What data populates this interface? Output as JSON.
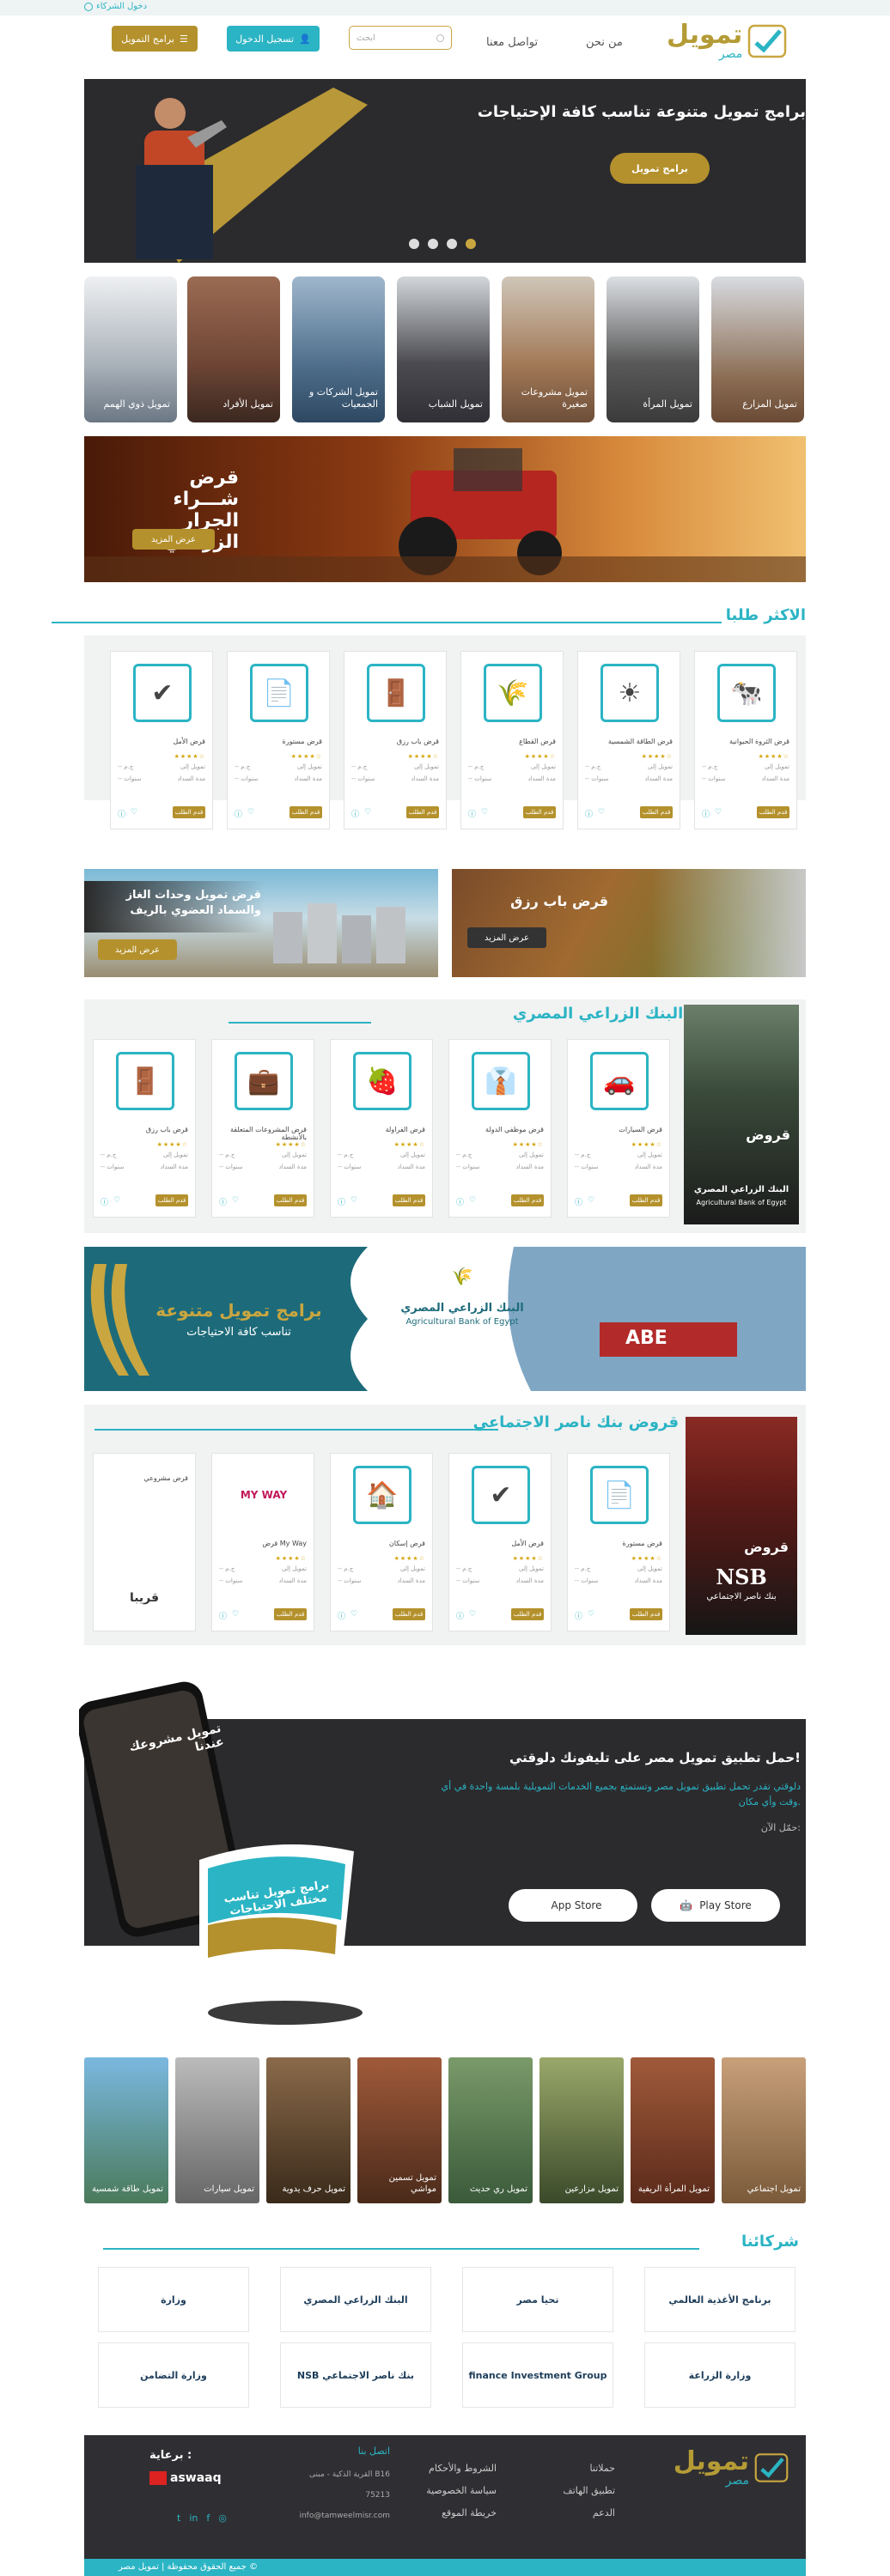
{
  "topbar": {
    "partners_login": "دخول الشركاء"
  },
  "header": {
    "logo_main": "تمويل",
    "logo_sub": "مصر",
    "nav": [
      "من نحن",
      "تواصل معنا"
    ],
    "search_placeholder": "ابحث",
    "login_label": "تسجيل الدخول",
    "programs_label": "برامج التمويل"
  },
  "hero": {
    "title": "برامج تمويل متنوعة تناسب كافة الإحتياجات",
    "cta": "برامج تمويل",
    "dots": 4,
    "active_dot": 4
  },
  "categories": [
    {
      "label": "تمويل المزارع"
    },
    {
      "label": "تمويل المرأة"
    },
    {
      "label": "تمويل مشروعات صغيرة"
    },
    {
      "label": "تمويل الشباب"
    },
    {
      "label": "تمويل الشركات و الجمعيات"
    },
    {
      "label": "تمويل الأفراد"
    },
    {
      "label": "تمويل ذوي الهمم"
    }
  ],
  "tractor_banner": {
    "title1": "قرض شـــراء",
    "title2": "الجرار الزراعي",
    "cta": "عرض المزيد"
  },
  "most_requested": {
    "title": "الاكثر طلبا",
    "cards": [
      {
        "title": "قرض الثروة الحيوانية",
        "icon": "🐄"
      },
      {
        "title": "قرض الطاقة الشمسية",
        "icon": "☀"
      },
      {
        "title": "قرض القطاع",
        "icon": "🌾"
      },
      {
        "title": "قرض باب رزق",
        "icon": "🚪"
      },
      {
        "title": "قرض مستورة",
        "icon": "📄"
      },
      {
        "title": "قرض الأمل",
        "icon": "✔"
      }
    ],
    "stars": "★★★★☆",
    "r1_left": "-- ج.م",
    "r1_right": "تمويل إلى",
    "r2_left": "-- سنوات",
    "r2_right": "مدة السداد",
    "apply": "قدم الطلب"
  },
  "promo_banners": [
    {
      "title": "قرض باب رزق",
      "cta": "عرض المزيد"
    },
    {
      "title": "قرض تمويل وحدات الغاز والسماد العضوي بالريف",
      "cta": "عرض المزيد"
    }
  ],
  "agri_bank": {
    "title": "قروض البنك الزراعي المصري",
    "side_label": "قروض",
    "side_bank_ar": "البنك الزراعي المصري",
    "side_bank_en": "Agricultural Bank of Egypt",
    "cards": [
      {
        "title": "قرض السيارات",
        "icon": "🚗"
      },
      {
        "title": "قرض موظفي الدولة",
        "icon": "👔"
      },
      {
        "title": "قرض الفراولة",
        "icon": "🍓"
      },
      {
        "title": "قرض المشروعات المتعلقة بالأنشطة",
        "icon": "💼"
      },
      {
        "title": "قرض باب رزق",
        "icon": "🚪"
      }
    ]
  },
  "abe_banner": {
    "bank_ar": "البنك الزراعي المصري",
    "bank_en": "Agricultural Bank of Egypt",
    "title": "برامج تمويل متنوعة",
    "subtitle": "تناسب كافة الاحتياجات",
    "abe": "ABE"
  },
  "nasser_bank": {
    "title": "قروض بنك ناصر الاجتماعي",
    "side_label": "قروض",
    "side_logo": "NSB",
    "side_name": "بنك ناصر الاجتماعي",
    "cards": [
      {
        "title": "قرض مستورة",
        "icon": "📄"
      },
      {
        "title": "قرض الأمل",
        "icon": "✔"
      },
      {
        "title": "قرض إسكان",
        "icon": "🏠"
      },
      {
        "title": "قرض My Way",
        "icon": "MY WAY"
      },
      {
        "title": "قرض مشروعي",
        "icon": ""
      }
    ],
    "soon": "قريبا"
  },
  "app": {
    "title": "حمل تطبيق تمويل مصر على تليفونك دلوقتي!",
    "desc": "دلوقتي تقدر تحمل تطبيق تمويل مصر وتستمتع بجميع الخدمات التمويلية بلمسة واحدة في أي وقت وأي مكان.",
    "now": "حمّل الآن:",
    "app_store": "App Store",
    "play_store": "Play Store",
    "phone_text": "تمويل مشروعك عندنا",
    "roll_text": "برامج تمويل تناسب مختلف الاحتياجات"
  },
  "services": [
    {
      "label": "تمويل اجتماعي"
    },
    {
      "label": "تمويل المرأة الريفية"
    },
    {
      "label": "تمويل مزارعين"
    },
    {
      "label": "تمويل ري حديث"
    },
    {
      "label": "تمويل تسمين مواشي"
    },
    {
      "label": "تمويل حرف يدوية"
    },
    {
      "label": "تمويل سيارات"
    },
    {
      "label": "تمويل طاقة شمسية"
    }
  ],
  "partners": {
    "title": "شركائنا",
    "row1": [
      "برنامج الأغذية العالمي",
      "تحيا مصر",
      "البنك الزراعي المصري",
      "وزارة"
    ],
    "row2": [
      "وزارة الزراعة",
      "finance Investment Group",
      "NSB بنك ناصر الاجتماعي",
      "وزارة التضامن"
    ]
  },
  "footer": {
    "logo_main": "تمويل",
    "logo_sub": "مصر",
    "col1": [
      "حملاتنا",
      "تطبيق الهاتف",
      "الدعم"
    ],
    "col2": [
      "الشروط والأحكام",
      "سياسة الخصوصية",
      "خريطة الموقع"
    ],
    "contact_title": "اتصل بنا",
    "contact": [
      "القرية الذكية - مبنى B16",
      "75213",
      "info@tamweelmisr.com"
    ],
    "sponsor_title": "برعاية :",
    "sponsor": "aswaaq",
    "copyright": "جميع الحقوق محفوظة | تمويل مصر ©"
  },
  "colors": {
    "teal": "#2bb4c4",
    "gold": "#b4912c",
    "dark": "#2b2b2e"
  }
}
